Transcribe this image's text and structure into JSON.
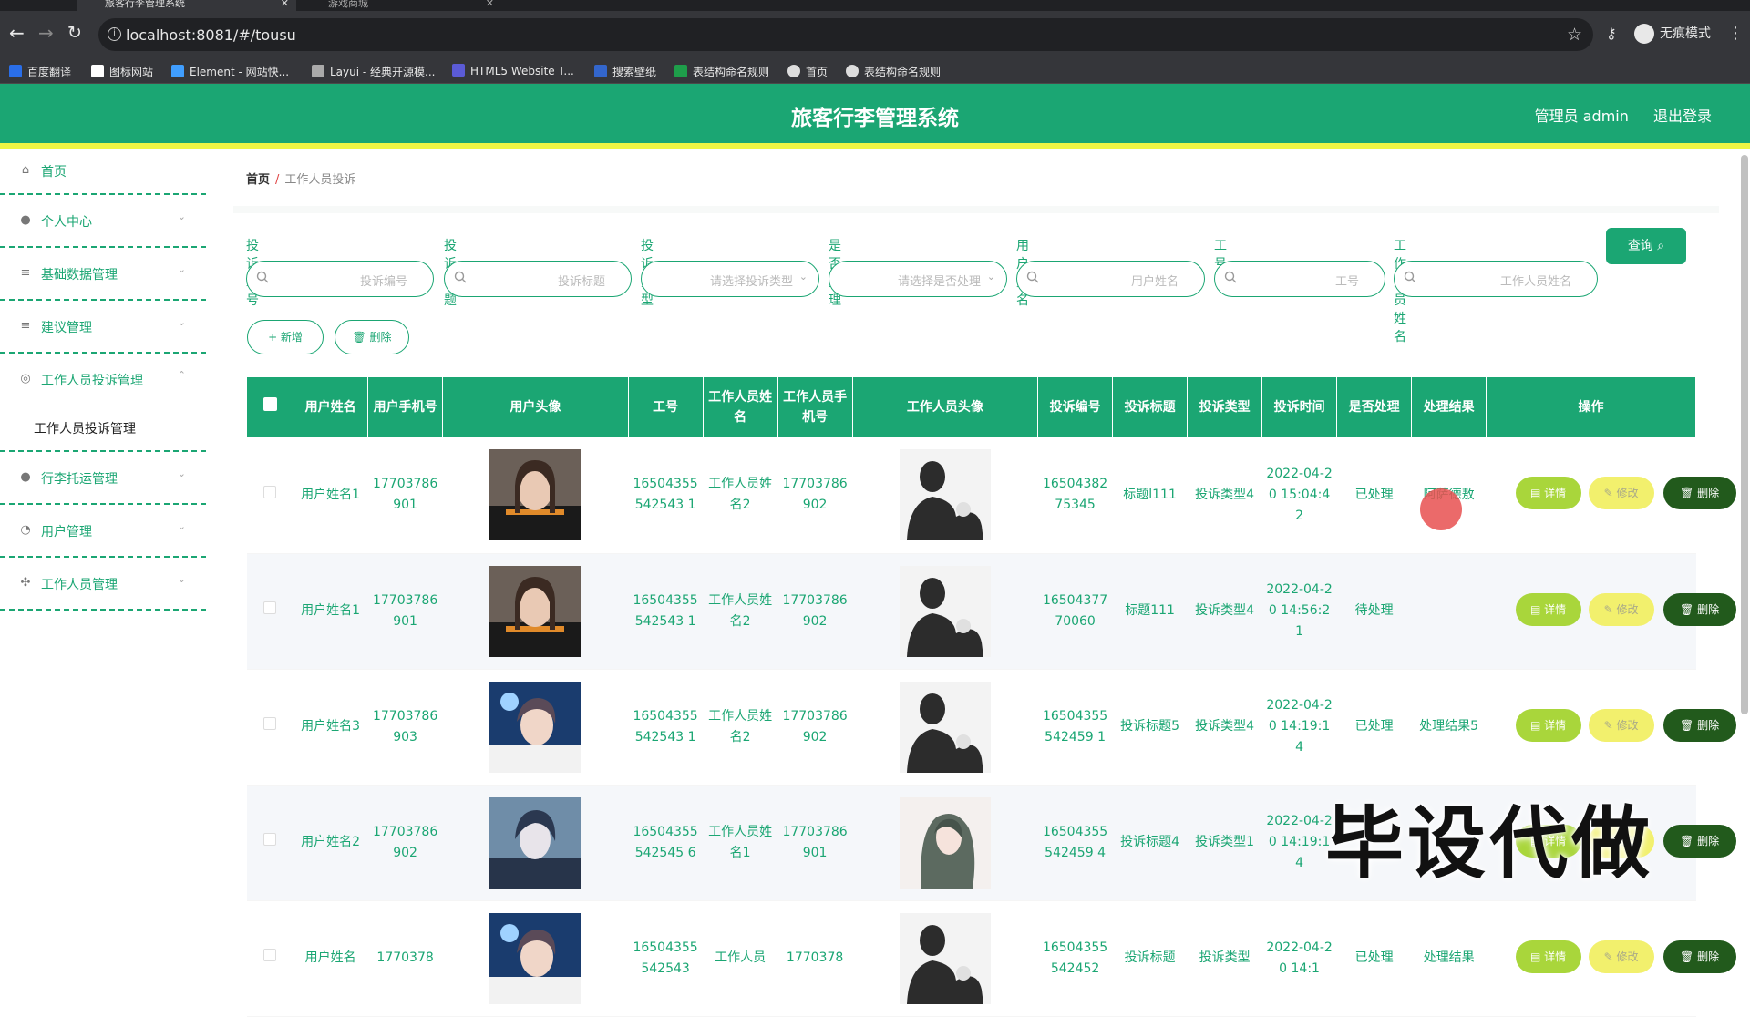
{
  "browser": {
    "tabs": [
      {
        "label": "旅客行李管理系统",
        "active": true
      },
      {
        "label": "游戏商城",
        "active": false
      }
    ],
    "url": "localhost:8081/#/tousu",
    "incognito_label": "无痕模式",
    "bookmarks": [
      {
        "label": "百度翻译",
        "color": "#2a6ee8"
      },
      {
        "label": "图标网站",
        "color": "#ffffff"
      },
      {
        "label": "Element - 网站快...",
        "color": "#409eff"
      },
      {
        "label": "Layui - 经典开源模...",
        "color": "#aaaaaa"
      },
      {
        "label": "HTML5 Website T...",
        "color": "#5b5bd6"
      },
      {
        "label": "搜索壁纸",
        "color": "#3366cc"
      },
      {
        "label": "表结构命名规则",
        "color": "#1e9e4a"
      },
      {
        "label": "首页",
        "color": "#dddddd"
      },
      {
        "label": "表结构命名规则",
        "color": "#dddddd"
      }
    ]
  },
  "app": {
    "title": "旅客行李管理系统",
    "user_label": "管理员 admin",
    "logout_label": "退出登录",
    "accent": "#1ba673"
  },
  "sidebar": {
    "items": [
      {
        "label": "首页",
        "icon": "home-icon"
      },
      {
        "label": "个人中心",
        "icon": "user-icon"
      },
      {
        "label": "基础数据管理",
        "icon": "menu-icon"
      },
      {
        "label": "建议管理",
        "icon": "menu-icon"
      },
      {
        "label": "工作人员投诉管理",
        "icon": "target-icon"
      },
      {
        "label": "行李托运管理",
        "icon": "bulb-icon"
      },
      {
        "label": "用户管理",
        "icon": "dashboard-icon"
      },
      {
        "label": "工作人员管理",
        "icon": "compass-icon"
      }
    ],
    "sub_item": "工作人员投诉管理"
  },
  "breadcrumb": {
    "home": "首页",
    "sep": "/",
    "current": "工作人员投诉"
  },
  "filters": [
    {
      "label": "投诉编号",
      "placeholder": "投诉编号"
    },
    {
      "label": "投诉标题",
      "placeholder": "投诉标题"
    },
    {
      "label": "投诉类型",
      "placeholder": "请选择投诉类型"
    },
    {
      "label": "是否处理",
      "placeholder": "请选择是否处理"
    },
    {
      "label": "用户姓名",
      "placeholder": "用户姓名"
    },
    {
      "label": "工号",
      "placeholder": "工号"
    },
    {
      "label": "工作人员姓名",
      "placeholder": "工作人员姓名"
    }
  ],
  "query_label": "查询",
  "actions": {
    "add": "+ 新增",
    "delete": "删除"
  },
  "table": {
    "headers": [
      "用户姓名",
      "用户手机号",
      "用户头像",
      "工号",
      "工作人员姓名",
      "工作人员手机号",
      "工作人员头像",
      "投诉编号",
      "投诉标题",
      "投诉类型",
      "投诉时间",
      "是否处理",
      "处理结果",
      "操作"
    ],
    "rows": [
      {
        "name": "用户姓名1",
        "phone": "17703786901",
        "avatar": "female-avatar",
        "jobno": "16504355542543 1",
        "staff": "工作人员姓名2",
        "staff_phone": "17703786902",
        "staff_avatar": "silhouette-avatar",
        "code": "1650438275345",
        "title": "标题l111",
        "type": "投诉类型4",
        "time": "2022-04-20 15:04:42",
        "handled": "已处理",
        "result": "阿萨德敖"
      },
      {
        "name": "用户姓名1",
        "phone": "17703786901",
        "avatar": "female-avatar",
        "jobno": "16504355542543 1",
        "staff": "工作人员姓名2",
        "staff_phone": "17703786902",
        "staff_avatar": "silhouette-avatar",
        "code": "1650437770060",
        "title": "标题111",
        "type": "投诉类型4",
        "time": "2022-04-20 14:56:21",
        "handled": "待处理",
        "result": ""
      },
      {
        "name": "用户姓名3",
        "phone": "17703786903",
        "avatar": "male-avatar",
        "jobno": "16504355542543 1",
        "staff": "工作人员姓名2",
        "staff_phone": "17703786902",
        "staff_avatar": "silhouette-avatar",
        "code": "16504355542459 1",
        "title": "投诉标题5",
        "type": "投诉类型4",
        "time": "2022-04-20 14:19:14",
        "handled": "已处理",
        "result": "处理结果5"
      },
      {
        "name": "用户姓名2",
        "phone": "17703786902",
        "avatar": "anime-male-avatar",
        "jobno": "16504355542545 6",
        "staff": "工作人员姓名1",
        "staff_phone": "17703786901",
        "staff_avatar": "anime-female-avatar",
        "code": "16504355542459 4",
        "title": "投诉标题4",
        "type": "投诉类型1",
        "time": "2022-04-20 14:19:14",
        "handled": "",
        "result": ""
      },
      {
        "name": "用户姓名",
        "phone": "1770378",
        "avatar": "male-avatar",
        "jobno": "16504355542543",
        "staff": "工作人员",
        "staff_phone": "1770378",
        "staff_avatar": "silhouette-avatar",
        "code": "16504355542452",
        "title": "投诉标题",
        "type": "投诉类型",
        "time": "2022-04-20 14:1",
        "handled": "已处理",
        "result": "处理结果"
      }
    ],
    "op_labels": {
      "detail": "详情",
      "edit": "修改",
      "delete": "删除"
    }
  },
  "watermark": "毕设代做"
}
